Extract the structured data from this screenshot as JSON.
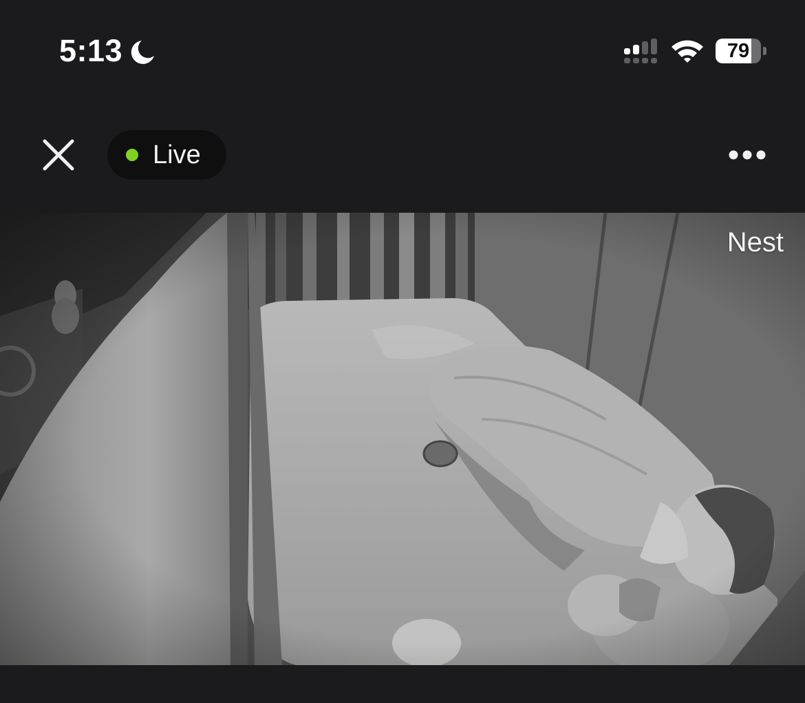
{
  "status_bar": {
    "time": "5:13",
    "battery_percent": "79",
    "battery_level": 0.79,
    "icons": [
      "moon-icon",
      "signal-icon",
      "wifi-icon",
      "battery-icon"
    ]
  },
  "top_bar": {
    "close_icon": "close-icon",
    "live_label": "Live",
    "live_dot_color": "#7ed321",
    "more_icon": "more-icon"
  },
  "feed": {
    "watermark": "Nest"
  }
}
